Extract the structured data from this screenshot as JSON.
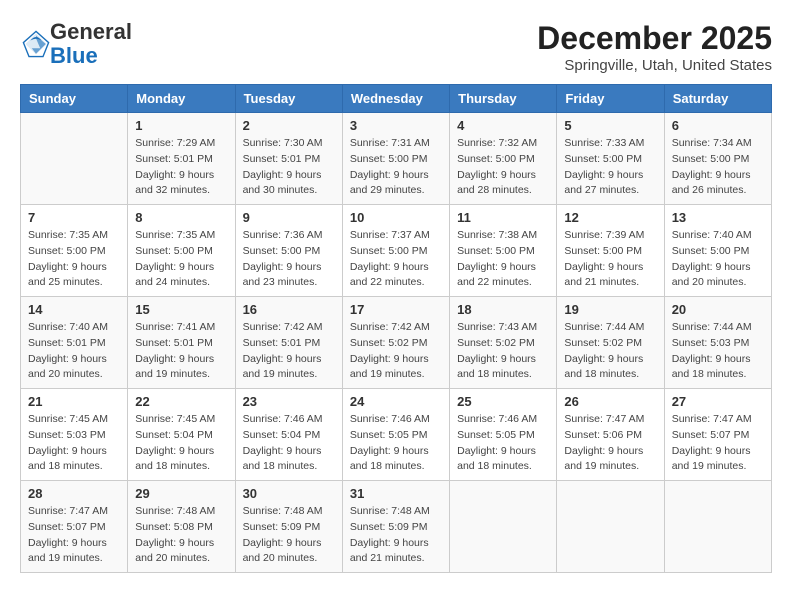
{
  "header": {
    "logo_general": "General",
    "logo_blue": "Blue",
    "month_title": "December 2025",
    "location": "Springville, Utah, United States"
  },
  "weekdays": [
    "Sunday",
    "Monday",
    "Tuesday",
    "Wednesday",
    "Thursday",
    "Friday",
    "Saturday"
  ],
  "weeks": [
    [
      {
        "day": "",
        "sunrise": "",
        "sunset": "",
        "daylight": ""
      },
      {
        "day": "1",
        "sunrise": "Sunrise: 7:29 AM",
        "sunset": "Sunset: 5:01 PM",
        "daylight": "Daylight: 9 hours and 32 minutes."
      },
      {
        "day": "2",
        "sunrise": "Sunrise: 7:30 AM",
        "sunset": "Sunset: 5:01 PM",
        "daylight": "Daylight: 9 hours and 30 minutes."
      },
      {
        "day": "3",
        "sunrise": "Sunrise: 7:31 AM",
        "sunset": "Sunset: 5:00 PM",
        "daylight": "Daylight: 9 hours and 29 minutes."
      },
      {
        "day": "4",
        "sunrise": "Sunrise: 7:32 AM",
        "sunset": "Sunset: 5:00 PM",
        "daylight": "Daylight: 9 hours and 28 minutes."
      },
      {
        "day": "5",
        "sunrise": "Sunrise: 7:33 AM",
        "sunset": "Sunset: 5:00 PM",
        "daylight": "Daylight: 9 hours and 27 minutes."
      },
      {
        "day": "6",
        "sunrise": "Sunrise: 7:34 AM",
        "sunset": "Sunset: 5:00 PM",
        "daylight": "Daylight: 9 hours and 26 minutes."
      }
    ],
    [
      {
        "day": "7",
        "sunrise": "Sunrise: 7:35 AM",
        "sunset": "Sunset: 5:00 PM",
        "daylight": "Daylight: 9 hours and 25 minutes."
      },
      {
        "day": "8",
        "sunrise": "Sunrise: 7:35 AM",
        "sunset": "Sunset: 5:00 PM",
        "daylight": "Daylight: 9 hours and 24 minutes."
      },
      {
        "day": "9",
        "sunrise": "Sunrise: 7:36 AM",
        "sunset": "Sunset: 5:00 PM",
        "daylight": "Daylight: 9 hours and 23 minutes."
      },
      {
        "day": "10",
        "sunrise": "Sunrise: 7:37 AM",
        "sunset": "Sunset: 5:00 PM",
        "daylight": "Daylight: 9 hours and 22 minutes."
      },
      {
        "day": "11",
        "sunrise": "Sunrise: 7:38 AM",
        "sunset": "Sunset: 5:00 PM",
        "daylight": "Daylight: 9 hours and 22 minutes."
      },
      {
        "day": "12",
        "sunrise": "Sunrise: 7:39 AM",
        "sunset": "Sunset: 5:00 PM",
        "daylight": "Daylight: 9 hours and 21 minutes."
      },
      {
        "day": "13",
        "sunrise": "Sunrise: 7:40 AM",
        "sunset": "Sunset: 5:00 PM",
        "daylight": "Daylight: 9 hours and 20 minutes."
      }
    ],
    [
      {
        "day": "14",
        "sunrise": "Sunrise: 7:40 AM",
        "sunset": "Sunset: 5:01 PM",
        "daylight": "Daylight: 9 hours and 20 minutes."
      },
      {
        "day": "15",
        "sunrise": "Sunrise: 7:41 AM",
        "sunset": "Sunset: 5:01 PM",
        "daylight": "Daylight: 9 hours and 19 minutes."
      },
      {
        "day": "16",
        "sunrise": "Sunrise: 7:42 AM",
        "sunset": "Sunset: 5:01 PM",
        "daylight": "Daylight: 9 hours and 19 minutes."
      },
      {
        "day": "17",
        "sunrise": "Sunrise: 7:42 AM",
        "sunset": "Sunset: 5:02 PM",
        "daylight": "Daylight: 9 hours and 19 minutes."
      },
      {
        "day": "18",
        "sunrise": "Sunrise: 7:43 AM",
        "sunset": "Sunset: 5:02 PM",
        "daylight": "Daylight: 9 hours and 18 minutes."
      },
      {
        "day": "19",
        "sunrise": "Sunrise: 7:44 AM",
        "sunset": "Sunset: 5:02 PM",
        "daylight": "Daylight: 9 hours and 18 minutes."
      },
      {
        "day": "20",
        "sunrise": "Sunrise: 7:44 AM",
        "sunset": "Sunset: 5:03 PM",
        "daylight": "Daylight: 9 hours and 18 minutes."
      }
    ],
    [
      {
        "day": "21",
        "sunrise": "Sunrise: 7:45 AM",
        "sunset": "Sunset: 5:03 PM",
        "daylight": "Daylight: 9 hours and 18 minutes."
      },
      {
        "day": "22",
        "sunrise": "Sunrise: 7:45 AM",
        "sunset": "Sunset: 5:04 PM",
        "daylight": "Daylight: 9 hours and 18 minutes."
      },
      {
        "day": "23",
        "sunrise": "Sunrise: 7:46 AM",
        "sunset": "Sunset: 5:04 PM",
        "daylight": "Daylight: 9 hours and 18 minutes."
      },
      {
        "day": "24",
        "sunrise": "Sunrise: 7:46 AM",
        "sunset": "Sunset: 5:05 PM",
        "daylight": "Daylight: 9 hours and 18 minutes."
      },
      {
        "day": "25",
        "sunrise": "Sunrise: 7:46 AM",
        "sunset": "Sunset: 5:05 PM",
        "daylight": "Daylight: 9 hours and 18 minutes."
      },
      {
        "day": "26",
        "sunrise": "Sunrise: 7:47 AM",
        "sunset": "Sunset: 5:06 PM",
        "daylight": "Daylight: 9 hours and 19 minutes."
      },
      {
        "day": "27",
        "sunrise": "Sunrise: 7:47 AM",
        "sunset": "Sunset: 5:07 PM",
        "daylight": "Daylight: 9 hours and 19 minutes."
      }
    ],
    [
      {
        "day": "28",
        "sunrise": "Sunrise: 7:47 AM",
        "sunset": "Sunset: 5:07 PM",
        "daylight": "Daylight: 9 hours and 19 minutes."
      },
      {
        "day": "29",
        "sunrise": "Sunrise: 7:48 AM",
        "sunset": "Sunset: 5:08 PM",
        "daylight": "Daylight: 9 hours and 20 minutes."
      },
      {
        "day": "30",
        "sunrise": "Sunrise: 7:48 AM",
        "sunset": "Sunset: 5:09 PM",
        "daylight": "Daylight: 9 hours and 20 minutes."
      },
      {
        "day": "31",
        "sunrise": "Sunrise: 7:48 AM",
        "sunset": "Sunset: 5:09 PM",
        "daylight": "Daylight: 9 hours and 21 minutes."
      },
      {
        "day": "",
        "sunrise": "",
        "sunset": "",
        "daylight": ""
      },
      {
        "day": "",
        "sunrise": "",
        "sunset": "",
        "daylight": ""
      },
      {
        "day": "",
        "sunrise": "",
        "sunset": "",
        "daylight": ""
      }
    ]
  ]
}
